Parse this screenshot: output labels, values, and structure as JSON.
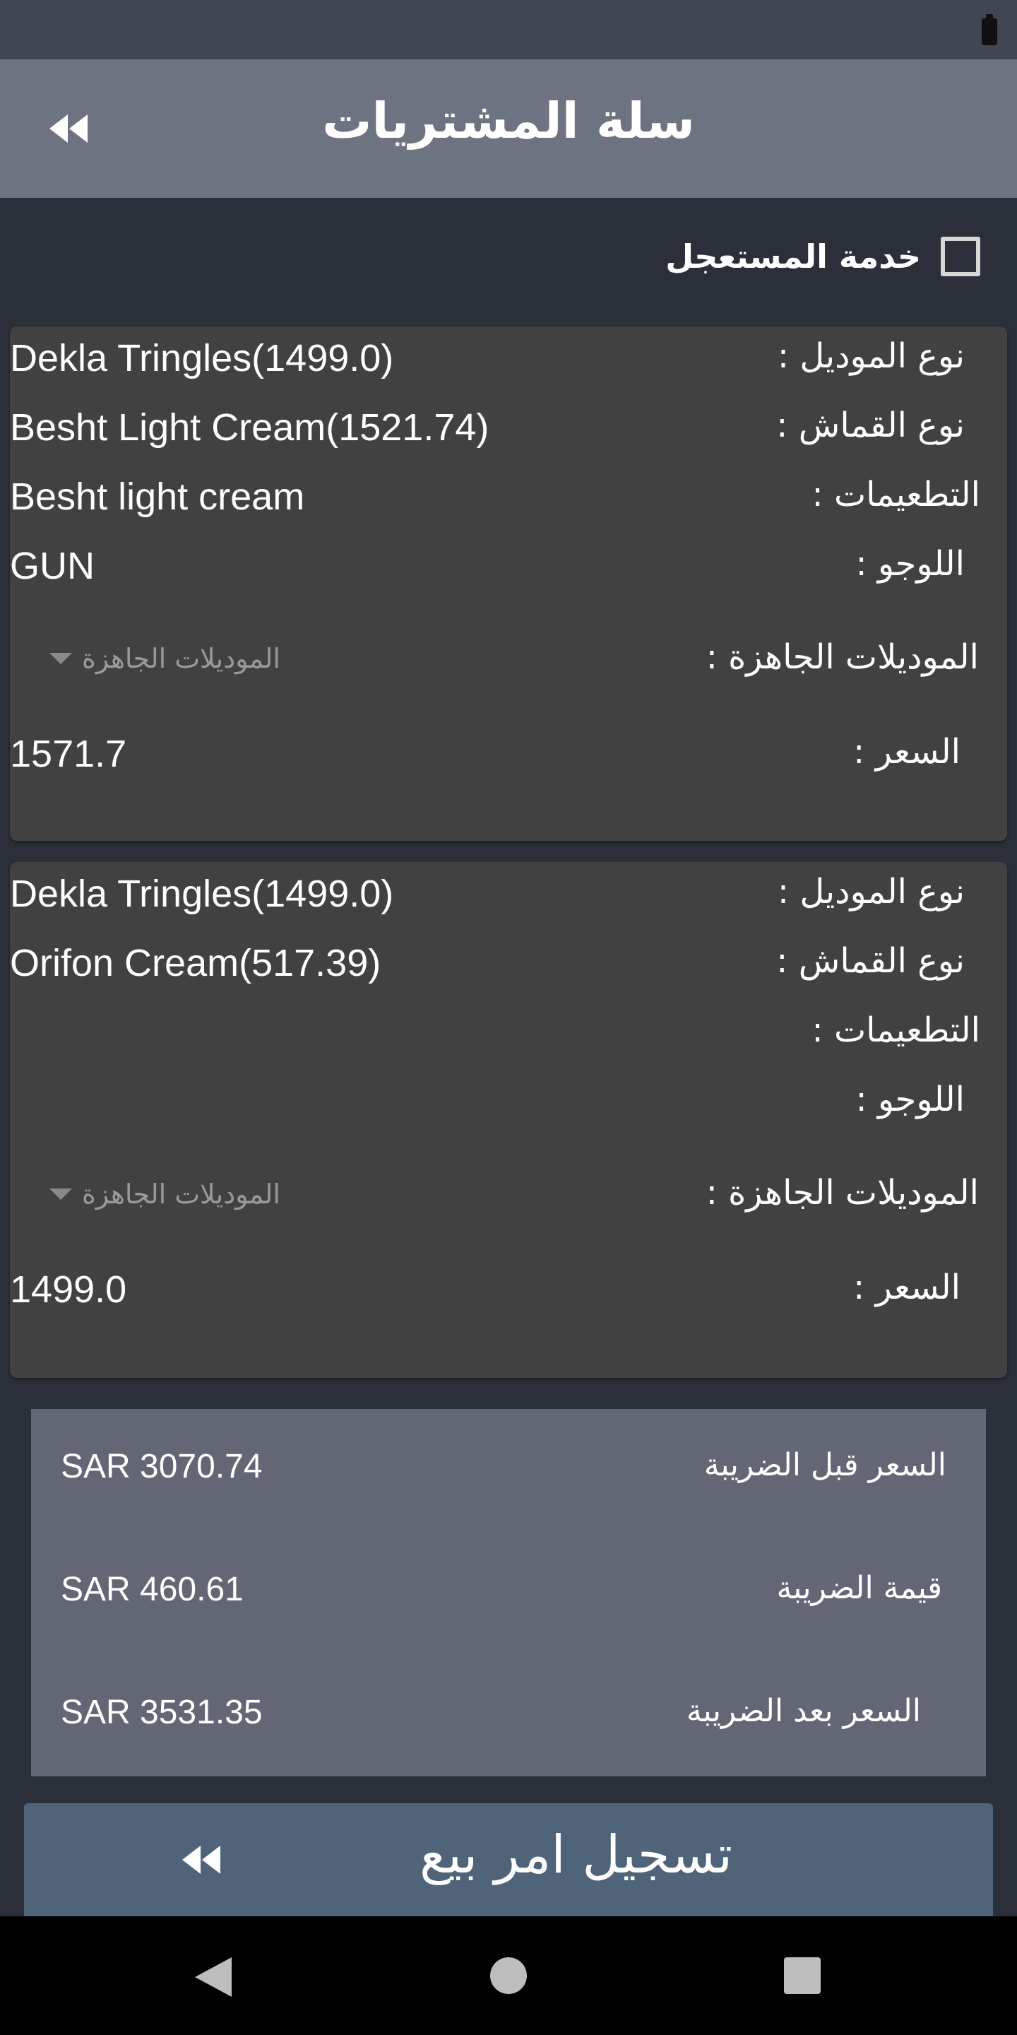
{
  "app_bar": {
    "title": "سلة المشتريات",
    "back_icon": "double-chevron-left-icon"
  },
  "express_service": {
    "label": "خدمة المستعجل",
    "checked": false
  },
  "cart_items": [
    {
      "model_label": "نوع الموديل :",
      "model_value": "Dekla Tringles(1499.0)",
      "fabric_label": "نوع القماش :",
      "fabric_value": "Besht Light Cream(1521.74)",
      "embroidery_label": "التطعيمات :",
      "embroidery_value": "Besht light cream",
      "logo_label": "اللوجو :",
      "logo_value": "GUN",
      "ready_models_label": "الموديلات الجاهزة :",
      "ready_models_dropdown": "الموديلات الجاهزة",
      "price_label": "السعر :",
      "price_value": "1571.7"
    },
    {
      "model_label": "نوع الموديل :",
      "model_value": "Dekla Tringles(1499.0)",
      "fabric_label": "نوع القماش :",
      "fabric_value": "Orifon Cream(517.39)",
      "embroidery_label": "التطعيمات :",
      "embroidery_value": "",
      "logo_label": "اللوجو :",
      "logo_value": "",
      "ready_models_label": "الموديلات الجاهزة :",
      "ready_models_dropdown": "الموديلات الجاهزة",
      "price_label": "السعر :",
      "price_value": "1499.0"
    }
  ],
  "summary": {
    "before_tax_label": "السعر قبل الضريبة",
    "before_tax_value": "SAR 3070.74",
    "tax_label": "قيمة الضريبة",
    "tax_value": "SAR 460.61",
    "after_tax_label": "السعر بعد الضريبة",
    "after_tax_value": "SAR 3531.35"
  },
  "submit_button": {
    "label": "تسجيل امر بيع"
  },
  "colors": {
    "background": "#2a2f3a",
    "app_bar": "#6e7381",
    "card": "#414141",
    "summary": "#636775",
    "button": "#4f6479"
  }
}
